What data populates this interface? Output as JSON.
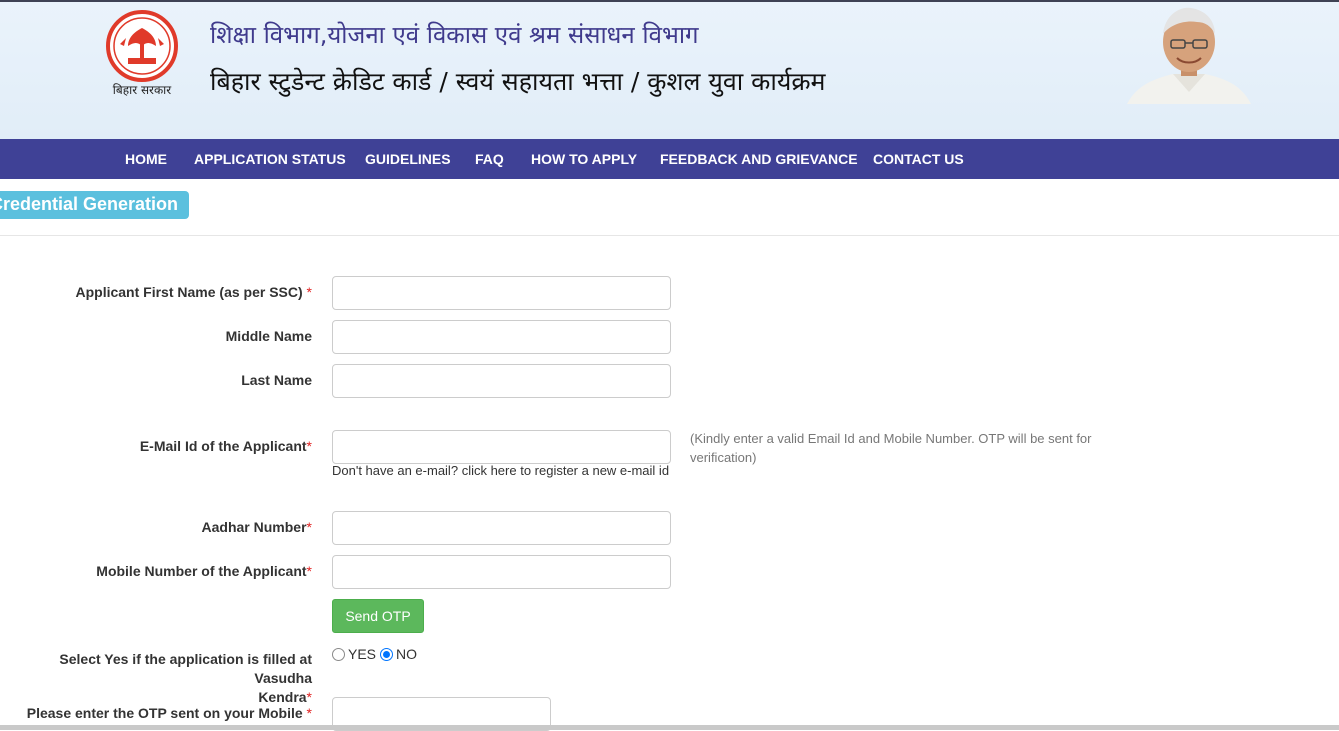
{
  "header": {
    "logo_caption": "बिहार सरकार",
    "title_line1": "शिक्षा विभाग,योजना एवं विकास एवं श्रम संसाधन विभाग",
    "title_line2": "बिहार स्टुडेन्ट क्रेडिट कार्ड / स्वयं सहायता भत्ता / कुशल युवा कार्यक्रम"
  },
  "nav": {
    "items": [
      {
        "label": "HOME"
      },
      {
        "label": "APPLICATION STATUS"
      },
      {
        "label": "GUIDELINES"
      },
      {
        "label": "FAQ"
      },
      {
        "label": "HOW TO APPLY"
      },
      {
        "label": "FEEDBACK AND GRIEVANCE"
      },
      {
        "label": "CONTACT US"
      }
    ]
  },
  "section": {
    "title": "Credential Generation"
  },
  "form": {
    "first_name": {
      "label": "Applicant First Name (as per SSC)",
      "required": "*",
      "value": ""
    },
    "middle_name": {
      "label": "Middle Name",
      "value": ""
    },
    "last_name": {
      "label": "Last Name",
      "value": ""
    },
    "email": {
      "label": "E-Mail Id of the Applicant",
      "required": "*",
      "value": "",
      "help_prefix": "Don't have an e-mail?",
      "help_link": "click here to register a new e-mail id",
      "hint": "(Kindly enter a valid Email Id and Mobile Number. OTP will be sent for verification)"
    },
    "aadhar": {
      "label": "Aadhar Number",
      "required": "*",
      "value": ""
    },
    "mobile": {
      "label": "Mobile Number of the Applicant",
      "required": "*",
      "value": ""
    },
    "send_otp_label": "Send OTP",
    "vasudha": {
      "label_line1": "Select Yes if the application is filled at Vasudha",
      "label_line2": "Kendra",
      "required": "*",
      "yes_label": "YES",
      "no_label": "NO",
      "selected": "NO"
    },
    "otp": {
      "label": "Please enter the OTP sent on your Mobile",
      "required": "*",
      "value": ""
    }
  },
  "colors": {
    "nav_bg": "#3f4196",
    "section_tab": "#5bc0de",
    "send_otp": "#5cb85c",
    "title_blue": "#3f3a8c",
    "required": "#e02020"
  }
}
